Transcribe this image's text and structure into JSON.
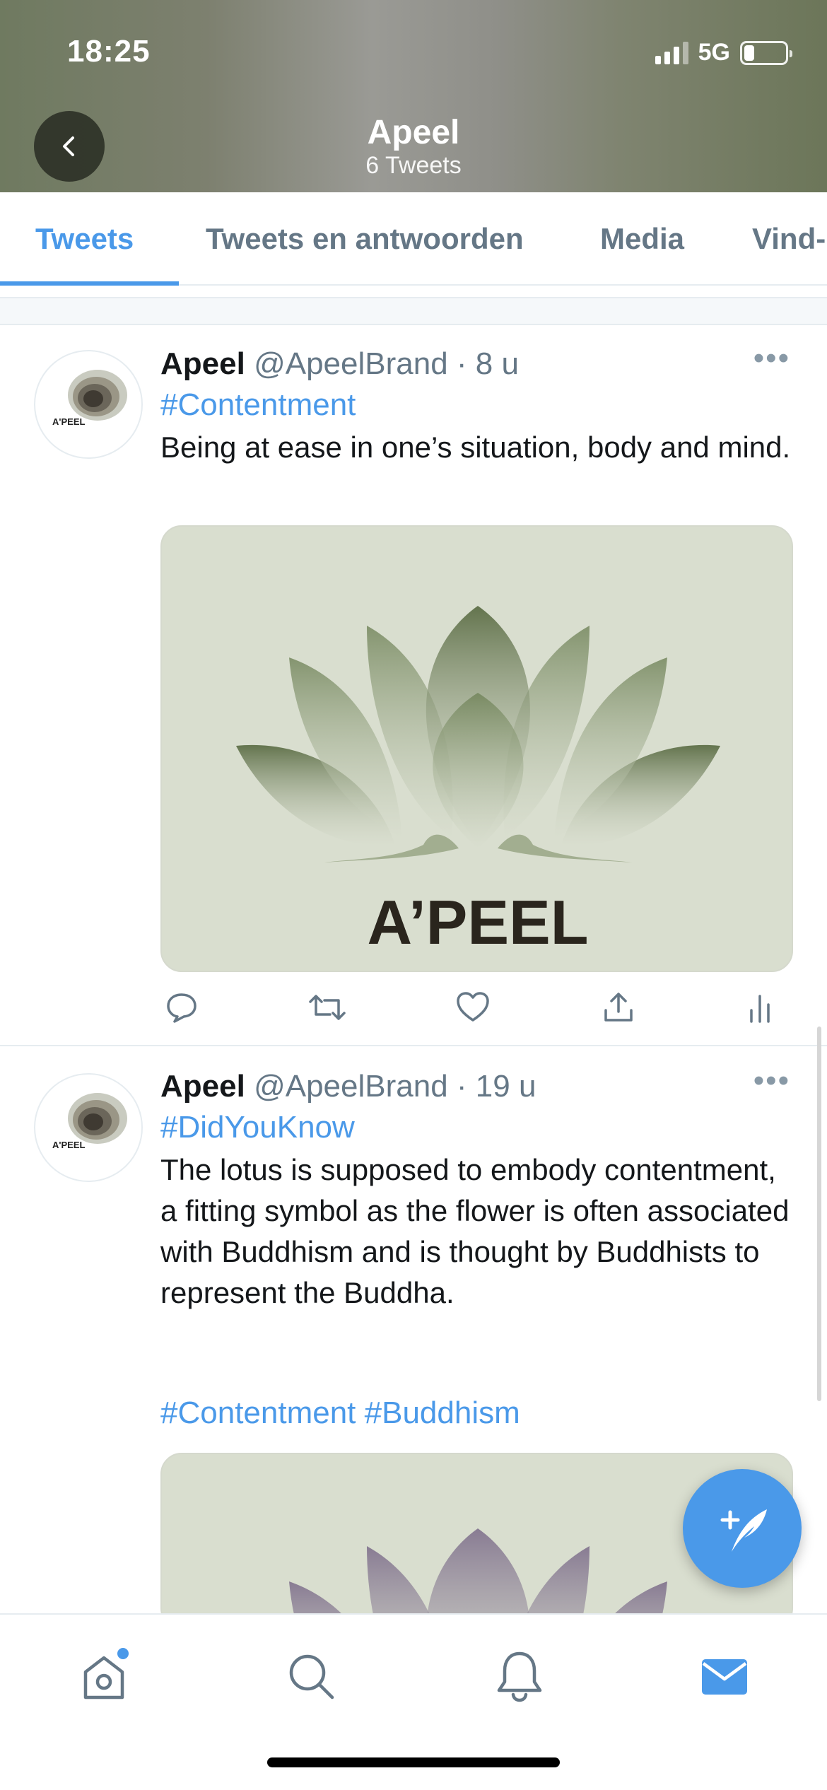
{
  "status_bar": {
    "time": "18:25",
    "network": "5G"
  },
  "header": {
    "title": "Apeel",
    "subtitle": "6 Tweets"
  },
  "tabs": [
    {
      "label": "Tweets",
      "active": true
    },
    {
      "label": "Tweets en antwoorden",
      "active": false
    },
    {
      "label": "Media",
      "active": false
    },
    {
      "label": "Vind-",
      "active": false
    }
  ],
  "tweets": [
    {
      "name": "Apeel",
      "handle": "@ApeelBrand",
      "time": "· 8 u",
      "hashtag": "#Contentment",
      "text": "Being at ease in one’s situation, body and mind.",
      "avatar_text": "A'PEEL",
      "media_text": "A’PEEL",
      "media_color": "#6f8257"
    },
    {
      "name": "Apeel",
      "handle": "@ApeelBrand",
      "time": "· 19 u",
      "hashtag": "#DidYouKnow",
      "text": "The lotus is supposed to embody contentment, a fitting symbol as the flower is often associated with Buddhism and is thought by Buddhists to represent the Buddha.",
      "tags_line": "#Contentment #Buddhism",
      "avatar_text": "A'PEEL",
      "media_color": "#8a7a96"
    }
  ],
  "colors": {
    "accent": "#4a99e9",
    "header_green": "#6c7659"
  },
  "icons": {
    "actions": [
      "reply-icon",
      "retweet-icon",
      "like-icon",
      "share-icon",
      "analytics-icon"
    ],
    "nav": [
      "home-icon",
      "search-icon",
      "notifications-icon",
      "messages-icon"
    ],
    "fab": "compose-tweet-icon"
  }
}
